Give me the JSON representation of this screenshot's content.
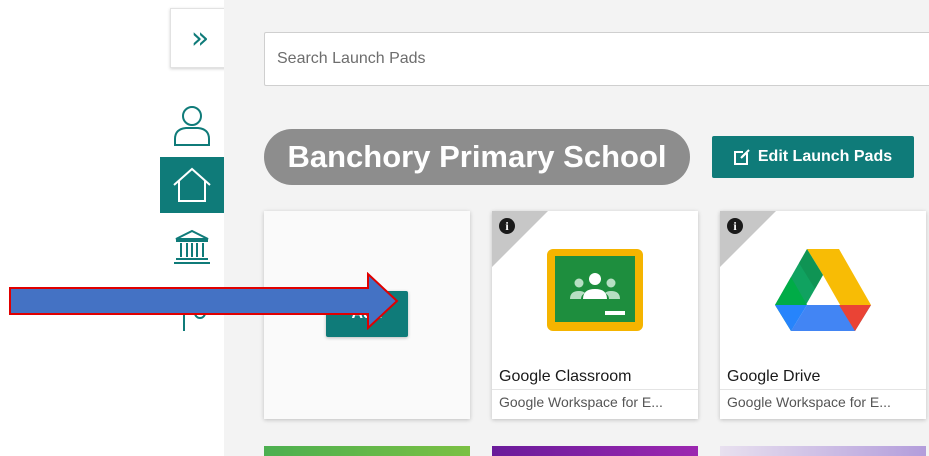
{
  "sidebar": {
    "expand_icon": "double-chevron-right-icon",
    "items": [
      {
        "icon": "user-icon",
        "active": false
      },
      {
        "icon": "home-icon",
        "active": true
      },
      {
        "icon": "institution-icon",
        "active": false
      }
    ]
  },
  "search": {
    "placeholder": "Search Launch Pads"
  },
  "header": {
    "school_name": "Banchory Primary School",
    "edit_button_label": "Edit Launch Pads",
    "edit_icon": "edit-icon"
  },
  "add_card": {
    "button_label": "Add"
  },
  "tiles": [
    {
      "title": "Google Classroom",
      "subtitle": "Google Workspace for E...",
      "logo": "google-classroom-logo"
    },
    {
      "title": "Google Drive",
      "subtitle": "Google Workspace for E...",
      "logo": "google-drive-logo"
    }
  ],
  "colors": {
    "accent": "#0f7b79",
    "pill": "#8d8d8d",
    "arrow_fill": "#4472c4",
    "arrow_stroke": "#e00000"
  }
}
